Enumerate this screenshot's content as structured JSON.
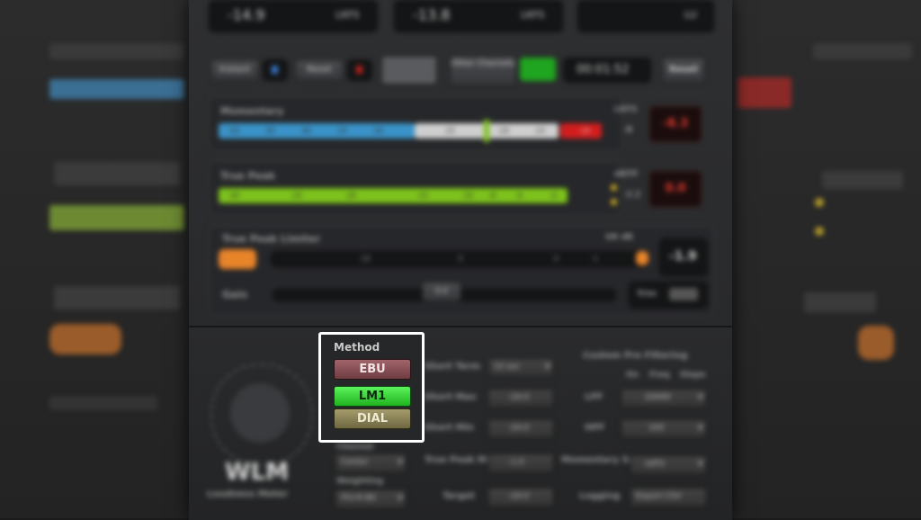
{
  "top_meters": [
    {
      "value": "-14.9",
      "unit": "LKFS"
    },
    {
      "value": "-13.8",
      "unit": "LKFS"
    },
    {
      "value": "",
      "unit": "LU"
    }
  ],
  "transport": {
    "buttons": [
      "Instant",
      "Reset"
    ],
    "time": "00:01:52",
    "reset_label": "Reset",
    "other_label": "Other Channels"
  },
  "momentary": {
    "label": "Momentary",
    "unit": "LKFS",
    "ticks": [
      "-50",
      "-45",
      "-40",
      "-35",
      "-30",
      "-25",
      "-20",
      "-15",
      "-10"
    ],
    "readout": "-8",
    "max": "-8.3",
    "level": 0.56
  },
  "true_peak": {
    "label": "True Peak",
    "unit": "dBTP",
    "ticks": [
      "-30",
      "-25",
      "-20",
      "-15",
      "-10",
      "-8",
      "-6",
      "-4"
    ],
    "readout": "-2.2",
    "max": "0.0",
    "level": 0.85
  },
  "limiter": {
    "label": "True Peak Limiter",
    "gr_label": "GR dB",
    "ticks": [
      "-10",
      "-5",
      "-3",
      "-1"
    ],
    "readout": "-1.9",
    "gain_label": "Gain",
    "trim_label": "Trim",
    "gain_value": "0.0"
  },
  "logo": {
    "name": "WLM",
    "subtitle": "Loudness Meter"
  },
  "method": {
    "title": "Method",
    "options": [
      "EBU",
      "LM1",
      "DIAL"
    ],
    "selected": "LM1"
  },
  "settings": {
    "short_term": {
      "label": "Short Term",
      "value": "10 sec"
    },
    "short_max": {
      "label": "Short Max",
      "value": "-24.0"
    },
    "short_min": {
      "label": "Short Min",
      "value": "-24.0"
    },
    "true_peak_max": {
      "label": "True Peak Max",
      "value": "-1.0"
    },
    "target": {
      "label": "Target",
      "value": "-24.0"
    },
    "loudness_left": {
      "label": "Channel",
      "value": "Center"
    },
    "weighting": {
      "label": "Weighting",
      "value": "ITU-R BS"
    }
  },
  "pre_filtering": {
    "title": "Custom Pre Filtering",
    "cols": [
      "On",
      "Freq",
      "Slope"
    ],
    "lpf_label": "LPF",
    "hpf_label": "HPF",
    "lpf_value": "20000",
    "hpf_value": "100",
    "momentary_scale": {
      "label": "Momentary Scale",
      "value": "LKFS"
    },
    "logging": {
      "label": "Logging",
      "value": "Export CSV"
    }
  },
  "colors": {
    "accent_green": "#3ee23e",
    "ebu_color": "#8a4f55",
    "dial_color": "#8b8456",
    "meter_blue": "#3a93c8",
    "meter_green": "#7dc21c",
    "meter_red": "#d21d1d",
    "limiter_orange": "#e8842a"
  }
}
